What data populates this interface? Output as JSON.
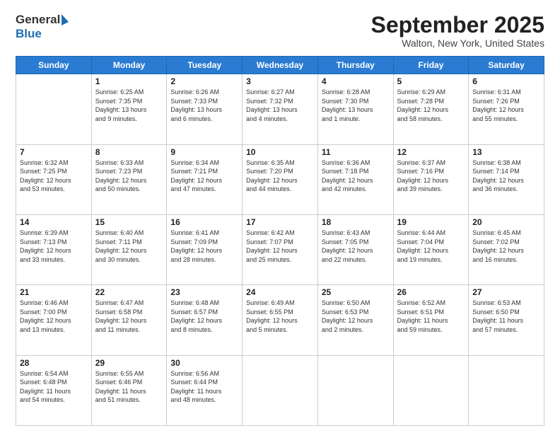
{
  "header": {
    "logo_general": "General",
    "logo_blue": "Blue",
    "month_title": "September 2025",
    "location": "Walton, New York, United States"
  },
  "days_of_week": [
    "Sunday",
    "Monday",
    "Tuesday",
    "Wednesday",
    "Thursday",
    "Friday",
    "Saturday"
  ],
  "weeks": [
    [
      {
        "day": "",
        "info": ""
      },
      {
        "day": "1",
        "info": "Sunrise: 6:25 AM\nSunset: 7:35 PM\nDaylight: 13 hours\nand 9 minutes."
      },
      {
        "day": "2",
        "info": "Sunrise: 6:26 AM\nSunset: 7:33 PM\nDaylight: 13 hours\nand 6 minutes."
      },
      {
        "day": "3",
        "info": "Sunrise: 6:27 AM\nSunset: 7:32 PM\nDaylight: 13 hours\nand 4 minutes."
      },
      {
        "day": "4",
        "info": "Sunrise: 6:28 AM\nSunset: 7:30 PM\nDaylight: 13 hours\nand 1 minute."
      },
      {
        "day": "5",
        "info": "Sunrise: 6:29 AM\nSunset: 7:28 PM\nDaylight: 12 hours\nand 58 minutes."
      },
      {
        "day": "6",
        "info": "Sunrise: 6:31 AM\nSunset: 7:26 PM\nDaylight: 12 hours\nand 55 minutes."
      }
    ],
    [
      {
        "day": "7",
        "info": "Sunrise: 6:32 AM\nSunset: 7:25 PM\nDaylight: 12 hours\nand 53 minutes."
      },
      {
        "day": "8",
        "info": "Sunrise: 6:33 AM\nSunset: 7:23 PM\nDaylight: 12 hours\nand 50 minutes."
      },
      {
        "day": "9",
        "info": "Sunrise: 6:34 AM\nSunset: 7:21 PM\nDaylight: 12 hours\nand 47 minutes."
      },
      {
        "day": "10",
        "info": "Sunrise: 6:35 AM\nSunset: 7:20 PM\nDaylight: 12 hours\nand 44 minutes."
      },
      {
        "day": "11",
        "info": "Sunrise: 6:36 AM\nSunset: 7:18 PM\nDaylight: 12 hours\nand 42 minutes."
      },
      {
        "day": "12",
        "info": "Sunrise: 6:37 AM\nSunset: 7:16 PM\nDaylight: 12 hours\nand 39 minutes."
      },
      {
        "day": "13",
        "info": "Sunrise: 6:38 AM\nSunset: 7:14 PM\nDaylight: 12 hours\nand 36 minutes."
      }
    ],
    [
      {
        "day": "14",
        "info": "Sunrise: 6:39 AM\nSunset: 7:13 PM\nDaylight: 12 hours\nand 33 minutes."
      },
      {
        "day": "15",
        "info": "Sunrise: 6:40 AM\nSunset: 7:11 PM\nDaylight: 12 hours\nand 30 minutes."
      },
      {
        "day": "16",
        "info": "Sunrise: 6:41 AM\nSunset: 7:09 PM\nDaylight: 12 hours\nand 28 minutes."
      },
      {
        "day": "17",
        "info": "Sunrise: 6:42 AM\nSunset: 7:07 PM\nDaylight: 12 hours\nand 25 minutes."
      },
      {
        "day": "18",
        "info": "Sunrise: 6:43 AM\nSunset: 7:05 PM\nDaylight: 12 hours\nand 22 minutes."
      },
      {
        "day": "19",
        "info": "Sunrise: 6:44 AM\nSunset: 7:04 PM\nDaylight: 12 hours\nand 19 minutes."
      },
      {
        "day": "20",
        "info": "Sunrise: 6:45 AM\nSunset: 7:02 PM\nDaylight: 12 hours\nand 16 minutes."
      }
    ],
    [
      {
        "day": "21",
        "info": "Sunrise: 6:46 AM\nSunset: 7:00 PM\nDaylight: 12 hours\nand 13 minutes."
      },
      {
        "day": "22",
        "info": "Sunrise: 6:47 AM\nSunset: 6:58 PM\nDaylight: 12 hours\nand 11 minutes."
      },
      {
        "day": "23",
        "info": "Sunrise: 6:48 AM\nSunset: 6:57 PM\nDaylight: 12 hours\nand 8 minutes."
      },
      {
        "day": "24",
        "info": "Sunrise: 6:49 AM\nSunset: 6:55 PM\nDaylight: 12 hours\nand 5 minutes."
      },
      {
        "day": "25",
        "info": "Sunrise: 6:50 AM\nSunset: 6:53 PM\nDaylight: 12 hours\nand 2 minutes."
      },
      {
        "day": "26",
        "info": "Sunrise: 6:52 AM\nSunset: 6:51 PM\nDaylight: 11 hours\nand 59 minutes."
      },
      {
        "day": "27",
        "info": "Sunrise: 6:53 AM\nSunset: 6:50 PM\nDaylight: 11 hours\nand 57 minutes."
      }
    ],
    [
      {
        "day": "28",
        "info": "Sunrise: 6:54 AM\nSunset: 6:48 PM\nDaylight: 11 hours\nand 54 minutes."
      },
      {
        "day": "29",
        "info": "Sunrise: 6:55 AM\nSunset: 6:46 PM\nDaylight: 11 hours\nand 51 minutes."
      },
      {
        "day": "30",
        "info": "Sunrise: 6:56 AM\nSunset: 6:44 PM\nDaylight: 11 hours\nand 48 minutes."
      },
      {
        "day": "",
        "info": ""
      },
      {
        "day": "",
        "info": ""
      },
      {
        "day": "",
        "info": ""
      },
      {
        "day": "",
        "info": ""
      }
    ]
  ]
}
